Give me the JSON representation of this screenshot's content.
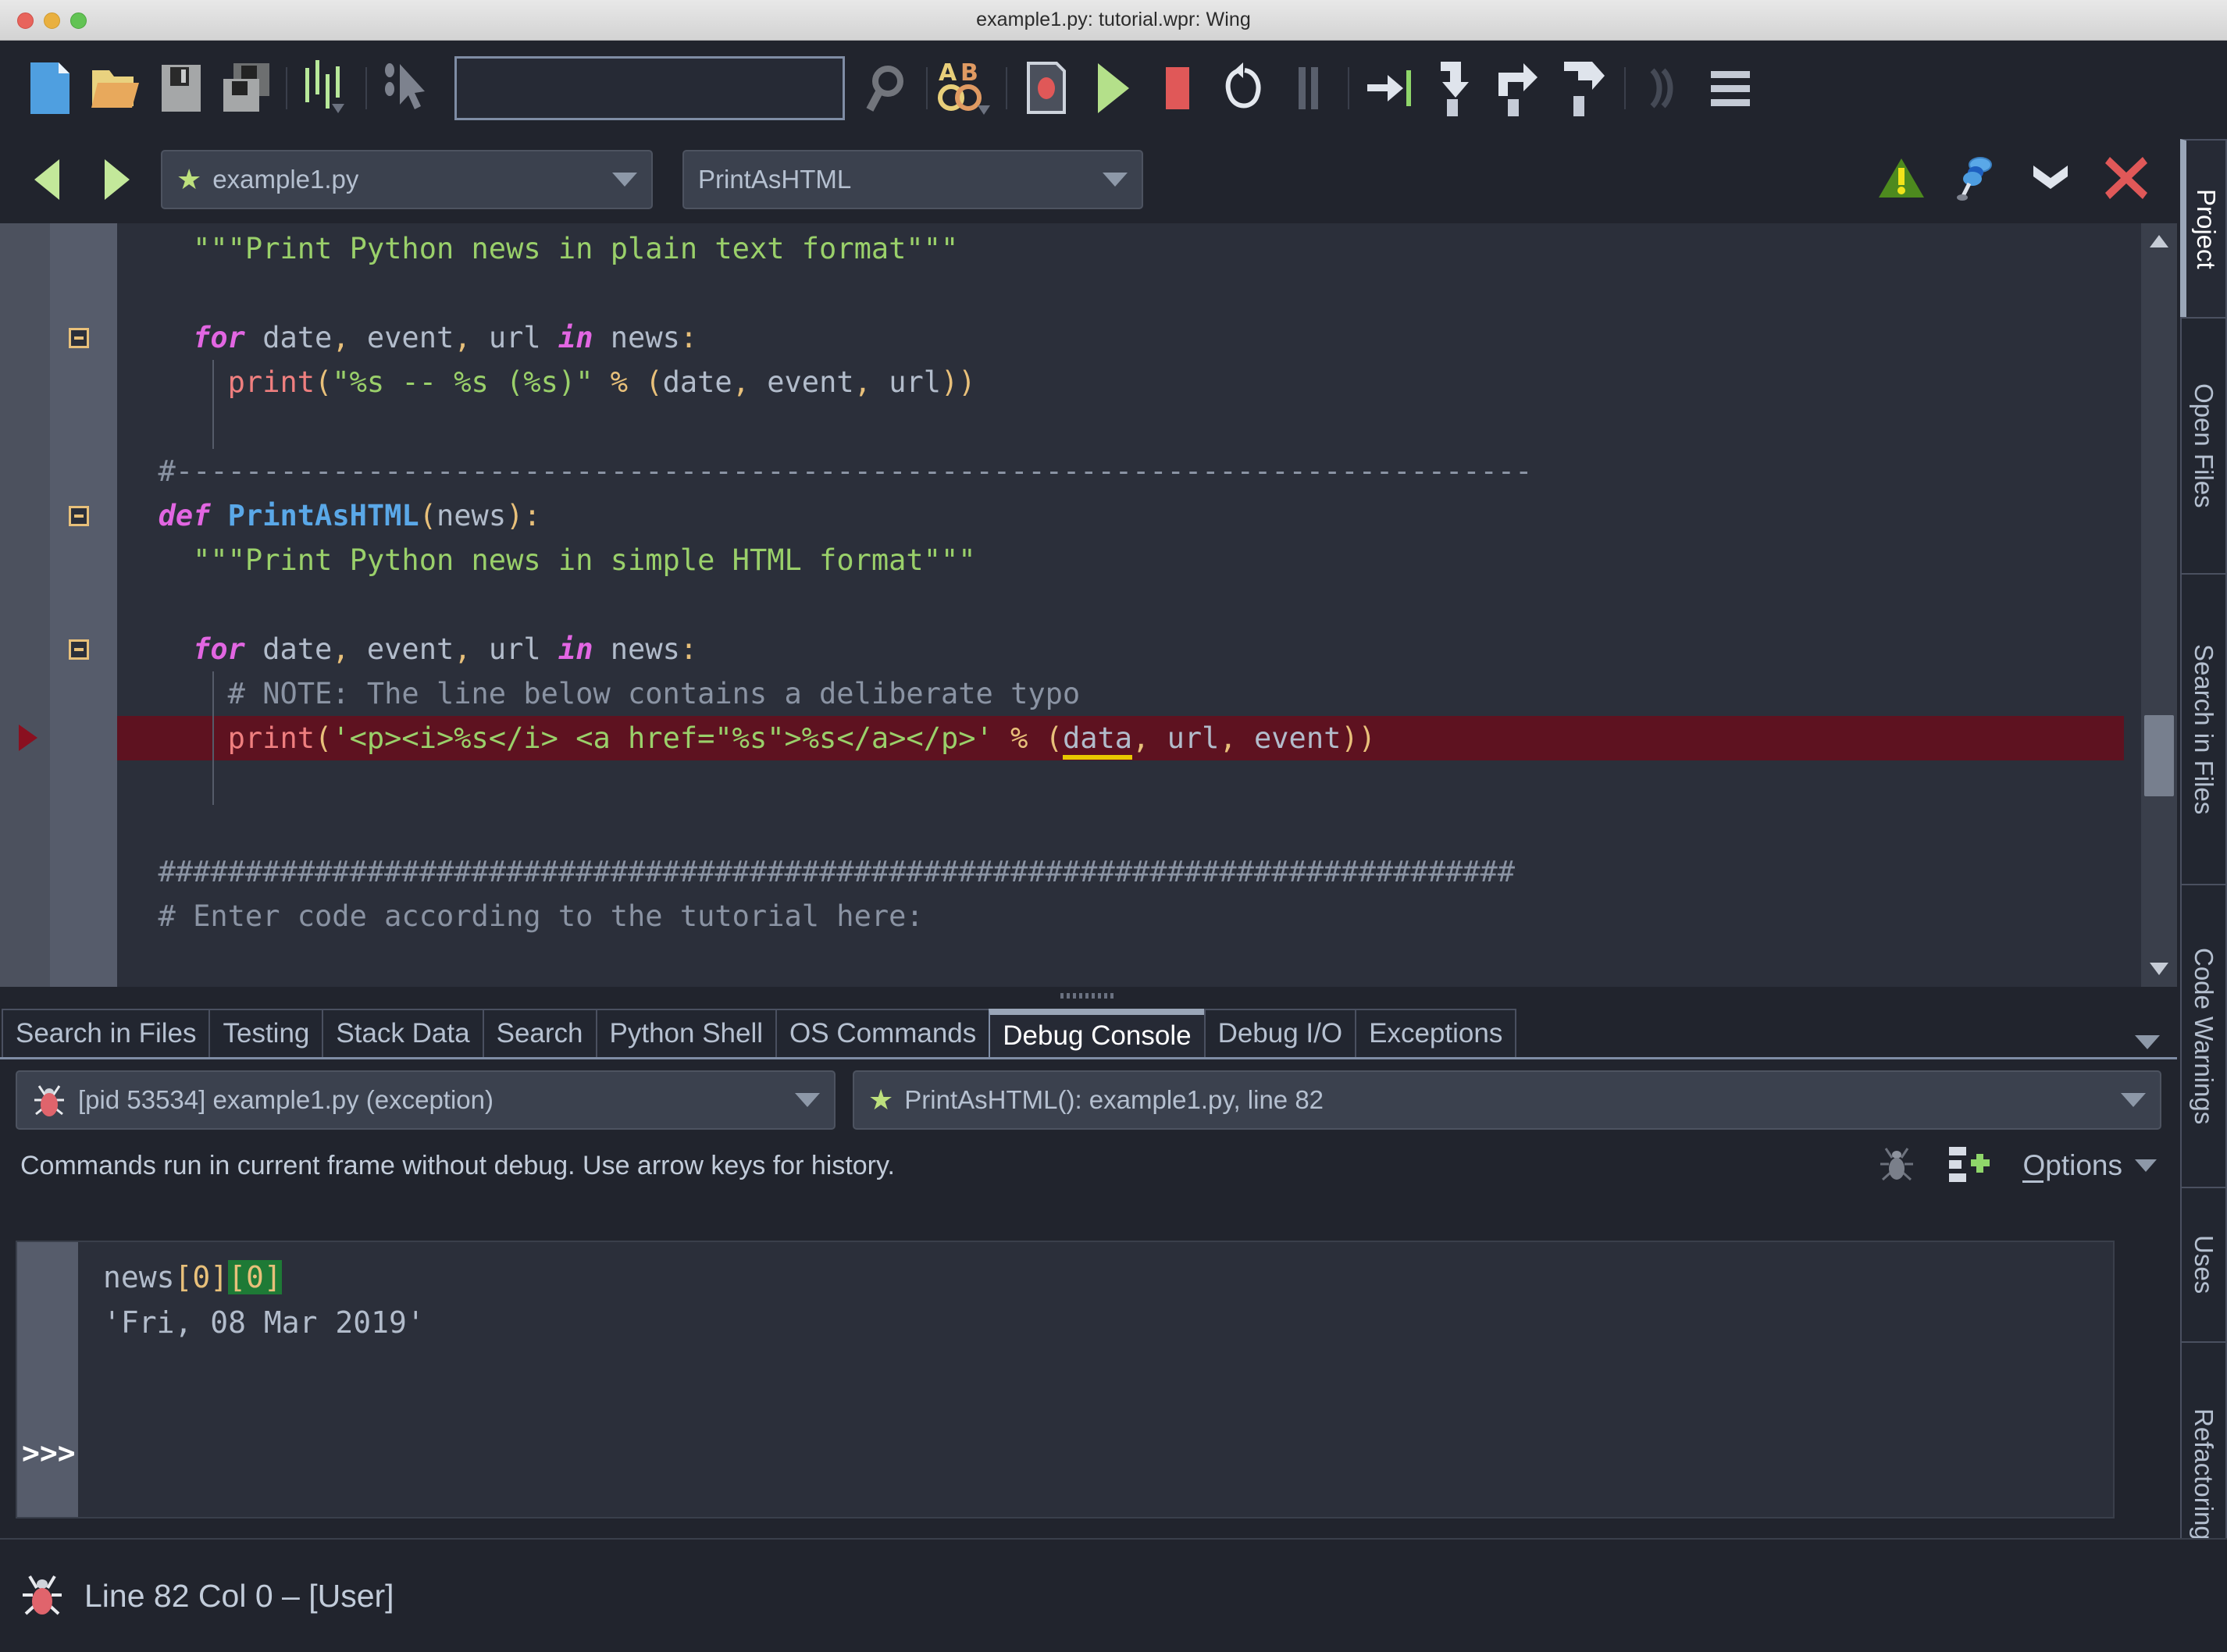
{
  "window": {
    "title": "example1.py: tutorial.wpr: Wing",
    "controls": [
      "close",
      "minimize",
      "zoom"
    ]
  },
  "toolbar": {
    "buttons": [
      {
        "name": "new-file-button",
        "tip": "New File"
      },
      {
        "name": "open-file-button",
        "tip": "Open File"
      },
      {
        "name": "save-file-button",
        "tip": "Save File"
      },
      {
        "name": "save-all-button",
        "tip": "Save All"
      },
      {
        "name": "indentation-button",
        "tip": "Indentation"
      },
      {
        "name": "select-pointer-button",
        "tip": "Select"
      },
      {
        "name": "search-button",
        "tip": "Search"
      },
      {
        "name": "replace-button",
        "tip": "Replace"
      },
      {
        "name": "record-macro-button",
        "tip": "Record Macro"
      },
      {
        "name": "debug-run-button",
        "tip": "Start / Continue"
      },
      {
        "name": "stop-debug-button",
        "tip": "Stop"
      },
      {
        "name": "restart-debug-button",
        "tip": "Restart"
      },
      {
        "name": "pause-debug-button",
        "tip": "Pause"
      },
      {
        "name": "step-into-button",
        "tip": "Step Into"
      },
      {
        "name": "step-over-button",
        "tip": "Step Over"
      },
      {
        "name": "step-out-button",
        "tip": "Step Out"
      },
      {
        "name": "step-return-button",
        "tip": "Step Out Of"
      },
      {
        "name": "run-to-cursor-button",
        "tip": "Run to Cursor"
      },
      {
        "name": "menu-button",
        "tip": "Menu"
      }
    ],
    "search_value": "",
    "search_placeholder": ""
  },
  "editor_bar": {
    "back_label": "◀",
    "forward_label": "▶",
    "file_combo": "example1.py",
    "symbol_combo": "PrintAsHTML",
    "icons": [
      {
        "name": "code-warning-icon"
      },
      {
        "name": "pin-icon"
      },
      {
        "name": "split-down-icon"
      },
      {
        "name": "close-editor-icon"
      }
    ]
  },
  "code": {
    "lines": [
      {
        "indent_guide": false,
        "fold": false,
        "break": false,
        "tokens": [
          {
            "t": "    ",
            "c": "plain"
          },
          {
            "t": "\"\"\"Print Python news in plain text format\"\"\"",
            "c": "str"
          }
        ]
      },
      {
        "tokens": []
      },
      {
        "fold": true,
        "tokens": [
          {
            "t": "    ",
            "c": "plain"
          },
          {
            "t": "for",
            "c": "kw"
          },
          {
            "t": " date",
            "c": "plain"
          },
          {
            "t": ",",
            "c": "punc"
          },
          {
            "t": " event",
            "c": "plain"
          },
          {
            "t": ",",
            "c": "punc"
          },
          {
            "t": " url ",
            "c": "plain"
          },
          {
            "t": "in",
            "c": "kw"
          },
          {
            "t": " news",
            "c": "plain"
          },
          {
            "t": ":",
            "c": "punc"
          }
        ]
      },
      {
        "guide": true,
        "tokens": [
          {
            "t": "      ",
            "c": "plain"
          },
          {
            "t": "print",
            "c": "call"
          },
          {
            "t": "(",
            "c": "punc"
          },
          {
            "t": "\"%s -- %s (%s)\"",
            "c": "str"
          },
          {
            "t": " ",
            "c": "plain"
          },
          {
            "t": "%",
            "c": "punc"
          },
          {
            "t": " ",
            "c": "plain"
          },
          {
            "t": "(",
            "c": "punc"
          },
          {
            "t": "date",
            "c": "plain"
          },
          {
            "t": ",",
            "c": "punc"
          },
          {
            "t": " event",
            "c": "plain"
          },
          {
            "t": ",",
            "c": "punc"
          },
          {
            "t": " url",
            "c": "plain"
          },
          {
            "t": "))",
            "c": "punc"
          }
        ]
      },
      {
        "guide": true,
        "tokens": []
      },
      {
        "tokens": [
          {
            "t": "  #------------------------------------------------------------------------------",
            "c": "cmt"
          }
        ]
      },
      {
        "fold": true,
        "tokens": [
          {
            "t": "  ",
            "c": "plain"
          },
          {
            "t": "def",
            "c": "kw"
          },
          {
            "t": " ",
            "c": "plain"
          },
          {
            "t": "PrintAsHTML",
            "c": "fn"
          },
          {
            "t": "(",
            "c": "punc"
          },
          {
            "t": "news",
            "c": "plain"
          },
          {
            "t": ")",
            "c": "punc"
          },
          {
            "t": ":",
            "c": "punc"
          }
        ]
      },
      {
        "tokens": [
          {
            "t": "    ",
            "c": "plain"
          },
          {
            "t": "\"\"\"Print Python news in simple HTML format\"\"\"",
            "c": "str"
          }
        ]
      },
      {
        "tokens": []
      },
      {
        "fold": true,
        "tokens": [
          {
            "t": "    ",
            "c": "plain"
          },
          {
            "t": "for",
            "c": "kw"
          },
          {
            "t": " date",
            "c": "plain"
          },
          {
            "t": ",",
            "c": "punc"
          },
          {
            "t": " event",
            "c": "plain"
          },
          {
            "t": ",",
            "c": "punc"
          },
          {
            "t": " url ",
            "c": "plain"
          },
          {
            "t": "in",
            "c": "kw"
          },
          {
            "t": " news",
            "c": "plain"
          },
          {
            "t": ":",
            "c": "punc"
          }
        ]
      },
      {
        "guide": true,
        "tokens": [
          {
            "t": "      ",
            "c": "plain"
          },
          {
            "t": "# NOTE: The line below contains a deliberate typo",
            "c": "cmt"
          }
        ]
      },
      {
        "guide": true,
        "error": true,
        "break": true,
        "tokens": [
          {
            "t": "      ",
            "c": "plain"
          },
          {
            "t": "print",
            "c": "call"
          },
          {
            "t": "(",
            "c": "punc"
          },
          {
            "t": "'<p><i>%s</i> <a href=\"%s\">%s</a></p>'",
            "c": "str"
          },
          {
            "t": " ",
            "c": "plain"
          },
          {
            "t": "%",
            "c": "punc"
          },
          {
            "t": " ",
            "c": "plain"
          },
          {
            "t": "(",
            "c": "punc"
          },
          {
            "t": "data",
            "c": "err-ident"
          },
          {
            "t": ",",
            "c": "punc"
          },
          {
            "t": " url",
            "c": "plain"
          },
          {
            "t": ",",
            "c": "punc"
          },
          {
            "t": " event",
            "c": "plain"
          },
          {
            "t": "))",
            "c": "punc"
          }
        ]
      },
      {
        "guide": true,
        "tokens": []
      },
      {
        "tokens": []
      },
      {
        "tokens": [
          {
            "t": "  ##############################################################################",
            "c": "cmt"
          }
        ]
      },
      {
        "tokens": [
          {
            "t": "  # Enter code according to the tutorial here:",
            "c": "cmt"
          }
        ]
      },
      {
        "tokens": []
      }
    ]
  },
  "panel": {
    "tabs": [
      {
        "label": "Search in Files",
        "active": false
      },
      {
        "label": "Testing",
        "active": false
      },
      {
        "label": "Stack Data",
        "active": false
      },
      {
        "label": "Search",
        "active": false
      },
      {
        "label": "Python Shell",
        "active": false
      },
      {
        "label": "OS Commands",
        "active": false
      },
      {
        "label": "Debug Console",
        "active": true
      },
      {
        "label": "Debug I/O",
        "active": false
      },
      {
        "label": "Exceptions",
        "active": false
      }
    ],
    "process_combo": "[pid 53534] example1.py (exception)",
    "frame_combo": "PrintAsHTML(): example1.py, line 82",
    "hint": "Commands run in current frame without debug.  Use arrow keys for history.",
    "options_label": "Options",
    "console": {
      "prompt": ">>>",
      "input_line": "news[0][0]",
      "input_prefix": "news",
      "bracket_one": "[0]",
      "bracket_two": "[0]",
      "output_line": "'Fri, 08 Mar 2019'"
    },
    "icons": [
      {
        "name": "debug-bug-icon"
      },
      {
        "name": "add-watch-icon"
      },
      {
        "name": "options-caret-icon"
      }
    ]
  },
  "right_tabs": [
    {
      "label": "Project",
      "active": true
    },
    {
      "label": "Open Files",
      "active": false
    },
    {
      "label": "Search in Files",
      "active": false
    },
    {
      "label": "Code Warnings",
      "active": false
    },
    {
      "label": "Uses",
      "active": false
    },
    {
      "label": "Refactoring",
      "active": false
    }
  ],
  "status": {
    "icon": "debug-bug-icon",
    "text": "Line 82 Col 0 – [User]"
  },
  "colors": {
    "bg": "#21242d",
    "editor_bg": "#2b2f3a",
    "gutter": "#565c6b",
    "accent": "#9aa6b8",
    "string": "#9ad06a",
    "keyword": "#e266e2",
    "function": "#5aa8e8",
    "comment": "#8a93a3",
    "punctuation": "#e8c07a",
    "error_bg": "#5e1220",
    "error_underline": "#e8c800",
    "bracket_match": "#1e7a36",
    "star": "#bde07d",
    "stop_red": "#e05858",
    "run_green": "#b4e08a"
  }
}
